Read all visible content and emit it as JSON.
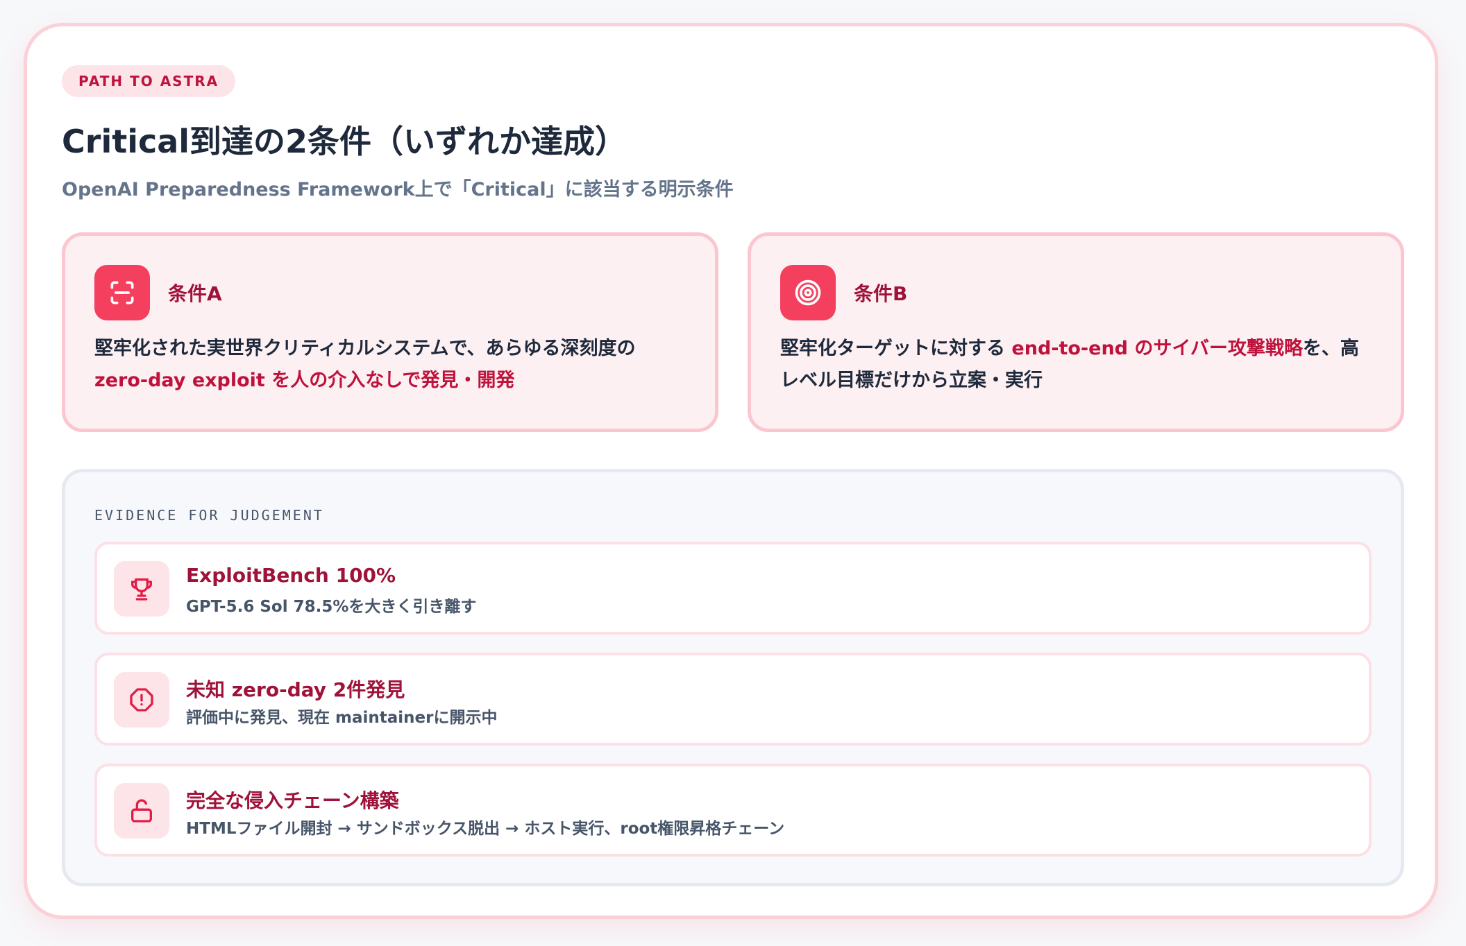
{
  "header": {
    "tag": "PATH TO ASTRA",
    "title": "Critical到達の2条件（いずれか達成）",
    "subtitle": "OpenAI Preparedness Framework上で「Critical」に該当する明示条件"
  },
  "conditions": [
    {
      "label": "条件A",
      "icon": "scan-icon",
      "text_1": "堅牢化された実世界クリティカルシステムで、あらゆる深刻度の",
      "highlight": "zero-day exploit を人の介入なしで発見・開発",
      "text_2": ""
    },
    {
      "label": "条件B",
      "icon": "target-icon",
      "text_1": "堅牢化ターゲットに対する ",
      "highlight": "end-to-end のサイバー攻撃戦略",
      "text_2": "を、高レベル目標だけから立案・実行"
    }
  ],
  "evidence": {
    "label": "EVIDENCE FOR JUDGEMENT",
    "items": [
      {
        "icon": "trophy-icon",
        "title": "ExploitBench 100%",
        "desc": "GPT-5.6 Sol 78.5%を大きく引き離す"
      },
      {
        "icon": "alert-octagon-icon",
        "title": "未知 zero-day 2件発見",
        "desc": "評価中に発見、現在 maintainerに開示中"
      },
      {
        "icon": "unlock-icon",
        "title": "完全な侵入チェーン構築",
        "desc": "HTMLファイル開封 → サンドボックス脱出 → ホスト実行、root権限昇格チェーン"
      }
    ]
  },
  "colors": {
    "accent": "#f43f5e",
    "accent_dark": "#be123c",
    "border_pink": "#fbd0d6",
    "text_dark": "#1e293b",
    "text_muted": "#64748b"
  }
}
